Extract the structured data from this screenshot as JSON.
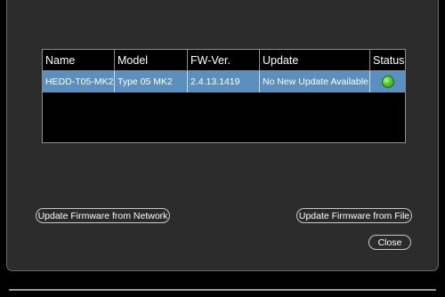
{
  "table": {
    "headers": {
      "name": "Name",
      "model": "Model",
      "fw_ver": "FW-Ver.",
      "update": "Update",
      "status": "Status"
    },
    "rows": [
      {
        "name": "HEDD-T05-MK2",
        "model": "Type 05 MK2",
        "fw_ver": "2.4.13.1419",
        "update": "No New Update Available",
        "status_color": "#4fc82a"
      }
    ],
    "selected_row_color": "#5b8fbd"
  },
  "buttons": {
    "update_network": "Update Firmware from Network",
    "update_file": "Update Firmware from File",
    "close": "Close"
  }
}
